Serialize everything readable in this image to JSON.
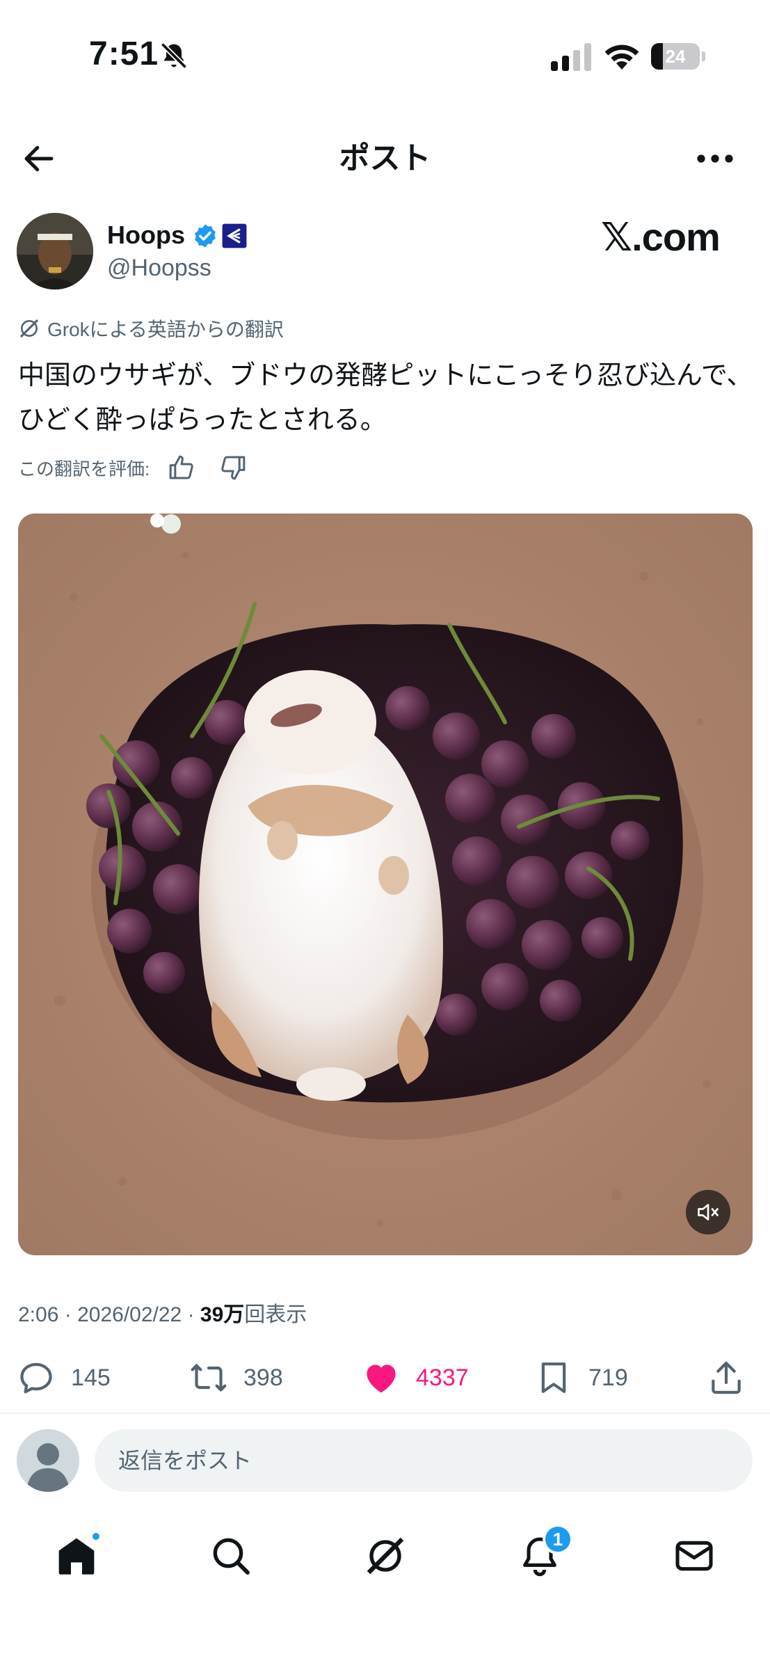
{
  "status_bar": {
    "time": "7:51",
    "battery": "24",
    "battery_level": 0.24
  },
  "header": {
    "title": "ポスト"
  },
  "author": {
    "name": "Hoops",
    "handle": "@Hoopss"
  },
  "watermark": "𝕏.com",
  "translation": {
    "note": "Grokによる英語からの翻訳",
    "rate_label": "この翻訳を評価:"
  },
  "tweet": {
    "text": "中国のウサギが、ブドウの発酵ピットにこっそり忍び込んで、ひどく酔っぱらったとされる。"
  },
  "media": {
    "description": "Rabbit lying on its back among grapes in a dirt pit",
    "muted": true
  },
  "meta": {
    "time": "2:06",
    "date": "2026/02/22",
    "views_count": "39万",
    "views_label": "回表示",
    "separator": "·"
  },
  "actions": {
    "replies": "145",
    "reposts": "398",
    "likes": "4337",
    "bookmarks": "719"
  },
  "reply": {
    "placeholder": "返信をポスト"
  },
  "tabbar": {
    "notification_count": "1"
  },
  "colors": {
    "accent": "#1d9bf0",
    "like": "#f91880",
    "secondary_text": "#536471"
  },
  "icons": [
    "back-arrow-icon",
    "more-icon",
    "verified-icon",
    "affiliate-badge-icon",
    "grok-icon",
    "thumbs-up-icon",
    "thumbs-down-icon",
    "mute-icon",
    "reply-icon",
    "repost-icon",
    "heart-icon",
    "bookmark-icon",
    "share-icon",
    "home-icon",
    "search-icon",
    "grok-icon",
    "bell-icon",
    "mail-icon"
  ]
}
